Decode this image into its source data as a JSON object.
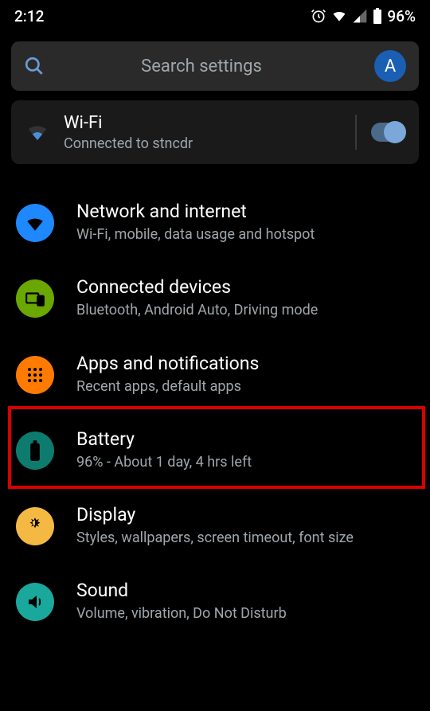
{
  "status": {
    "time": "2:12",
    "battery_text": "96%"
  },
  "search": {
    "placeholder": "Search settings",
    "avatar_letter": "A"
  },
  "wifi_card": {
    "title": "Wi-Fi",
    "subtitle": "Connected to stncdr",
    "enabled": true
  },
  "items": [
    {
      "title": "Network and internet",
      "sub": "Wi-Fi, mobile, data usage and hotspot",
      "icon_bg": "#1e88ff",
      "icon": "wifi"
    },
    {
      "title": "Connected devices",
      "sub": "Bluetooth, Android Auto, Driving mode",
      "icon_bg": "#6aa700",
      "icon": "devices"
    },
    {
      "title": "Apps and notifications",
      "sub": "Recent apps, default apps",
      "icon_bg": "#ff7a00",
      "icon": "apps"
    },
    {
      "title": "Battery",
      "sub": "96% - About 1 day, 4 hrs left",
      "icon_bg": "#0d7c6e",
      "icon": "battery",
      "highlight": true
    },
    {
      "title": "Display",
      "sub": "Styles, wallpapers, screen timeout, font size",
      "icon_bg": "#f4b942",
      "icon": "display"
    },
    {
      "title": "Sound",
      "sub": "Volume, vibration, Do Not Disturb",
      "icon_bg": "#1aa89c",
      "icon": "sound"
    }
  ]
}
